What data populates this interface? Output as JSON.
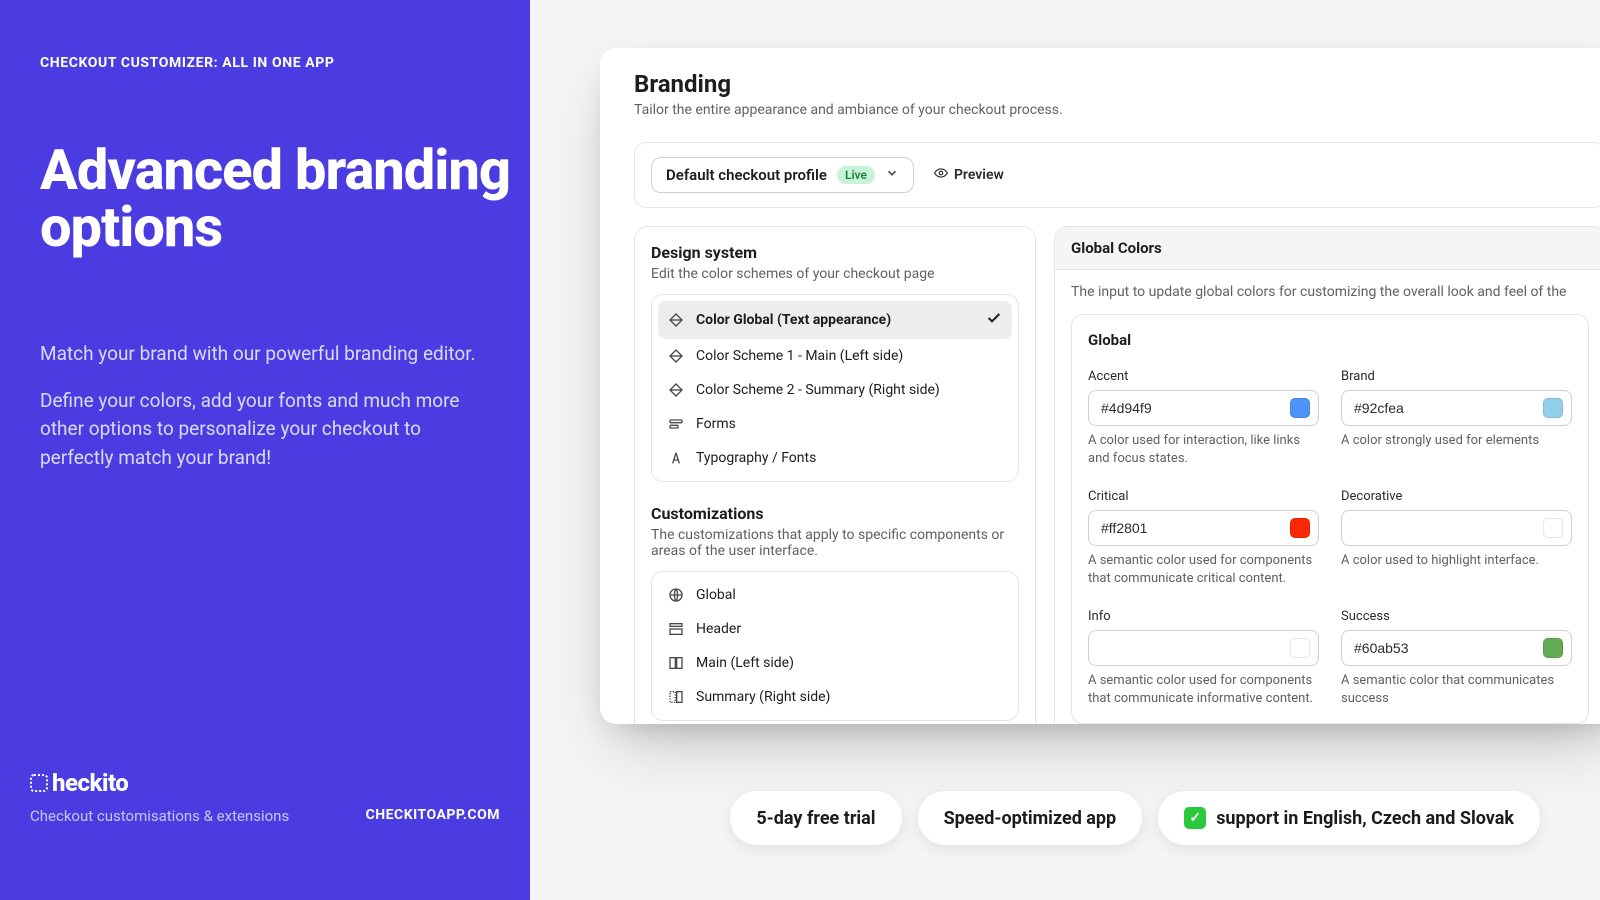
{
  "left": {
    "eyebrow": "CHECKOUT CUSTOMIZER: ALL IN ONE APP",
    "headline": "Advanced branding options",
    "subhead_1": "Match your brand with our powerful branding editor.",
    "subhead_2": "Define your colors, add your fonts and much more other options to personalize your checkout to perfectly match your brand!",
    "brand_name": "heckito",
    "brand_sub": "Checkout customisations & extensions",
    "brand_url": "CHECKITOAPP.COM"
  },
  "app": {
    "title": "Branding",
    "description": "Tailor the entire appearance and ambiance of your checkout process.",
    "profile_label": "Default checkout profile",
    "live_label": "Live",
    "preview_label": "Preview",
    "design": {
      "title": "Design system",
      "desc": "Edit the color schemes of your checkout page",
      "items": [
        {
          "label": "Color Global (Text appearance)",
          "selected": true
        },
        {
          "label": "Color Scheme 1 - Main (Left side)"
        },
        {
          "label": "Color Scheme 2 - Summary (Right side)"
        },
        {
          "label": "Forms"
        },
        {
          "label": "Typography / Fonts"
        }
      ]
    },
    "custom": {
      "title": "Customizations",
      "desc": "The customizations that apply to specific components or areas of the user interface.",
      "items": [
        {
          "label": "Global"
        },
        {
          "label": "Header"
        },
        {
          "label": "Main (Left side)"
        },
        {
          "label": "Summary (Right side)"
        }
      ]
    },
    "colors": {
      "panel_title": "Global Colors",
      "panel_desc": "The input to update global colors for customizing the overall look and feel of the",
      "section_title": "Global",
      "fields": [
        {
          "label": "Accent",
          "value": "#4d94f9",
          "hint": "A color used for interaction, like links and focus states."
        },
        {
          "label": "Brand",
          "value": "#92cfea",
          "hint": "A color strongly used for elements"
        },
        {
          "label": "Critical",
          "value": "#ff2801",
          "hint": "A semantic color used for components that communicate critical content."
        },
        {
          "label": "Decorative",
          "value": "",
          "hint": "A color used to highlight interface."
        },
        {
          "label": "Info",
          "value": "",
          "hint": "A semantic color used for components that communicate informative content."
        },
        {
          "label": "Success",
          "value": "#60ab53",
          "hint": "A semantic color that communicates success"
        }
      ]
    }
  },
  "pills": {
    "trial": "5-day free trial",
    "speed": "Speed-optimized app",
    "support": "support in English, Czech and Slovak"
  }
}
